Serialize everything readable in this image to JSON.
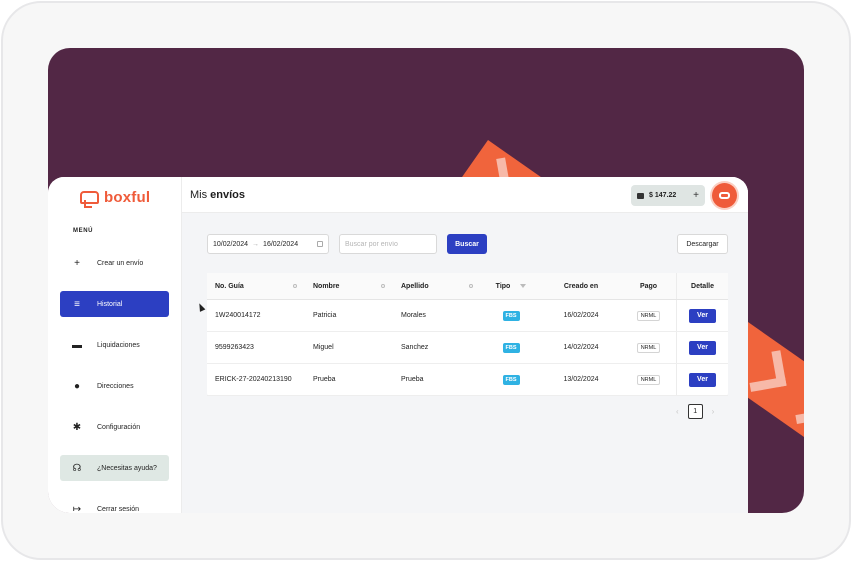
{
  "brand": {
    "name": "boxful",
    "color": "#ef5b3a"
  },
  "sidebar": {
    "menu_title": "MENÚ",
    "items": [
      {
        "label": "Crear un envío",
        "icon": "plus-icon"
      },
      {
        "label": "Historial",
        "icon": "history-search-icon",
        "active": true
      },
      {
        "label": "Liquidaciones",
        "icon": "cash-icon"
      },
      {
        "label": "Direcciones",
        "icon": "location-pin-icon"
      },
      {
        "label": "Configuración",
        "icon": "gear-icon"
      },
      {
        "label": "¿Necesitas ayuda?",
        "icon": "headset-icon"
      },
      {
        "label": "Cerrar sesión",
        "icon": "logout-icon"
      }
    ]
  },
  "header": {
    "title_prefix": "Mis",
    "title_bold": "envíos",
    "balance": "$ 147.22",
    "balance_add": "+"
  },
  "filters": {
    "date_from": "10/02/2024",
    "date_arrow": "→",
    "date_to": "16/02/2024",
    "search_placeholder": "Buscar por envío",
    "search_button": "Buscar",
    "download_button": "Descargar"
  },
  "table": {
    "columns": [
      "No. Guía",
      "Nombre",
      "Apellido",
      "Tipo",
      "Creado en",
      "Pago",
      "Detalle"
    ],
    "rows": [
      {
        "guia": "1W240014172",
        "nombre": "Patricia",
        "apellido": "Morales",
        "tipo": "FBS",
        "creado": "16/02/2024",
        "pago": "NRML",
        "detalle": "Ver"
      },
      {
        "guia": "9599263423",
        "nombre": "Miguel",
        "apellido": "Sanchez",
        "tipo": "FBS",
        "creado": "14/02/2024",
        "pago": "NRML",
        "detalle": "Ver"
      },
      {
        "guia": "ERICK-27-20240213190",
        "nombre": "Prueba",
        "apellido": "Prueba",
        "tipo": "FBS",
        "creado": "13/02/2024",
        "pago": "NRML",
        "detalle": "Ver"
      }
    ]
  },
  "pagination": {
    "prev": "‹",
    "current": "1",
    "next": "›"
  },
  "colors": {
    "primary": "#2c3fc2",
    "accent": "#ef5b3a",
    "badge": "#2fb2e3",
    "background": "#522745"
  }
}
